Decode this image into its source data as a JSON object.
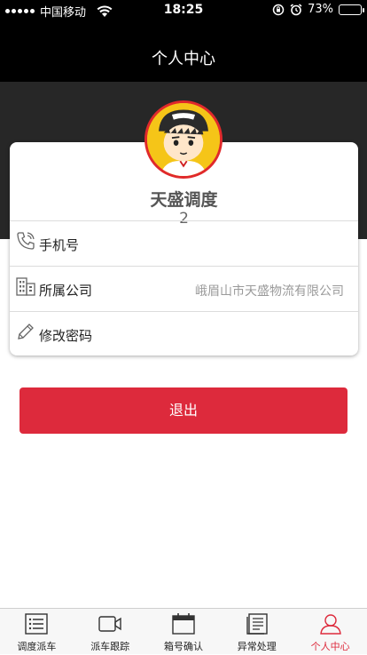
{
  "status_bar": {
    "carrier": "中国移动",
    "time": "18:25",
    "battery_percent": "73%",
    "battery_level": 0.73
  },
  "nav": {
    "title": "个人中心"
  },
  "profile": {
    "name": "天盛调度",
    "code": "2"
  },
  "rows": [
    {
      "label": "手机号",
      "value": ""
    },
    {
      "label": "所属公司",
      "value": "峨眉山市天盛物流有限公司"
    },
    {
      "label": "修改密码",
      "value": ""
    }
  ],
  "logout_label": "退出",
  "tabs": [
    {
      "label": "调度派车",
      "icon": "list-icon"
    },
    {
      "label": "派车跟踪",
      "icon": "video-icon"
    },
    {
      "label": "箱号确认",
      "icon": "calendar-icon"
    },
    {
      "label": "异常处理",
      "icon": "document-icon"
    },
    {
      "label": "个人中心",
      "icon": "user-icon",
      "active": true
    }
  ],
  "colors": {
    "accent": "#dd2a3c",
    "header": "#000000",
    "band": "#272727",
    "battery": "#4cd964"
  }
}
